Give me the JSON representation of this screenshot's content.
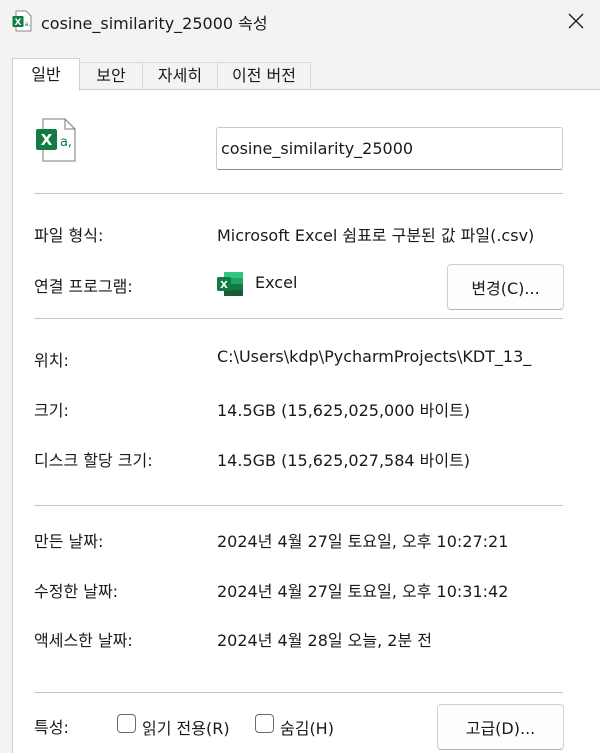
{
  "window": {
    "title": "cosine_similarity_25000 속성",
    "close_glyph": "✕"
  },
  "tabs": [
    {
      "label": "일반",
      "active": true
    },
    {
      "label": "보안",
      "active": false
    },
    {
      "label": "자세히",
      "active": false
    },
    {
      "label": "이전 버전",
      "active": false
    }
  ],
  "file": {
    "name": "cosine_similarity_25000",
    "icon": "excel-csv-file-icon",
    "icon_letter": "X",
    "icon_mark": "a,"
  },
  "type_section": {
    "file_type_label": "파일 형식:",
    "file_type_value": "Microsoft Excel 쉼표로 구분된 값 파일(.csv)",
    "opens_with_label": "연결 프로그램:",
    "opens_with_app": "Excel",
    "change_button": "변경(C)..."
  },
  "location_section": {
    "location_label": "위치:",
    "location_value": "C:\\Users\\kdp\\PycharmProjects\\KDT_13_",
    "size_label": "크기:",
    "size_value": "14.5GB (15,625,025,000 바이트)",
    "disk_size_label": "디스크 할당 크기:",
    "disk_size_value": "14.5GB (15,625,027,584 바이트)"
  },
  "dates_section": {
    "created_label": "만든 날짜:",
    "created_value": "2024년 4월 27일 토요일, 오후 10:27:21",
    "modified_label": "수정한 날짜:",
    "modified_value": "2024년 4월 27일 토요일, 오후 10:31:42",
    "accessed_label": "액세스한 날짜:",
    "accessed_value": "2024년 4월 28일 오늘, 2분 전"
  },
  "attributes": {
    "label": "특성:",
    "readonly_label": "읽기 전용(R)",
    "readonly_checked": false,
    "hidden_label": "숨김(H)",
    "hidden_checked": false,
    "advanced_button": "고급(D)..."
  },
  "colors": {
    "excel_green": "#107c41",
    "excel_dark": "#185c37",
    "excel_light": "#21a366"
  }
}
